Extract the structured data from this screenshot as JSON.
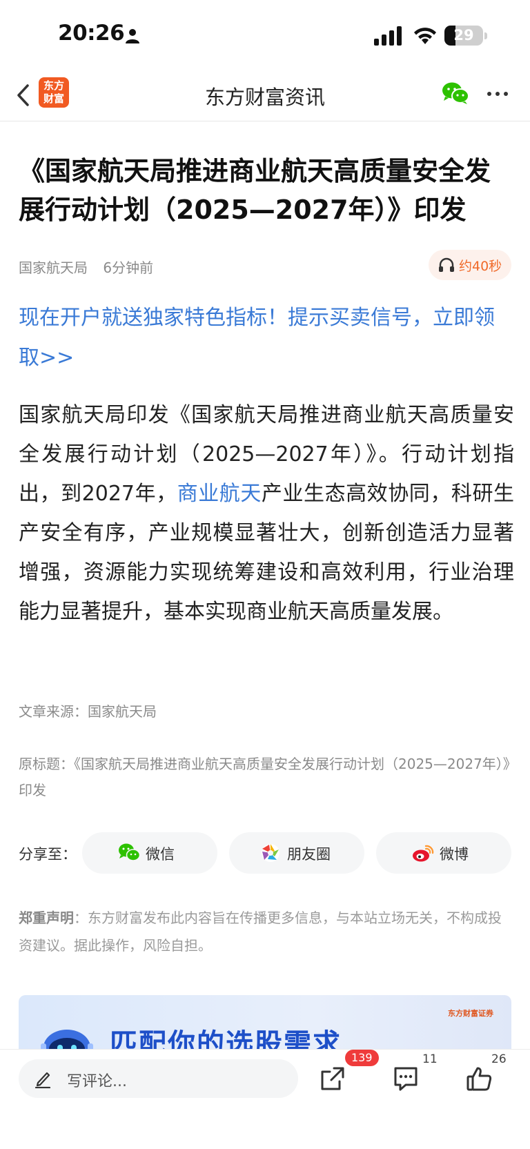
{
  "status_bar": {
    "time": "20:26",
    "battery": "29",
    "battery_fraction": 0.29
  },
  "nav": {
    "logo_line1": "东方",
    "logo_line2": "财富",
    "title": "东方财富资讯"
  },
  "article": {
    "title": "《国家航天局推进商业航天高质量安全发展行动计划（2025—2027年）》印发",
    "author": "国家航天局",
    "time_ago": "6分钟前",
    "audio_duration": "约40秒",
    "promo_link": "现在开户就送独家特色指标！提示买卖信号，立即领取>>",
    "body_before_link": "国家航天局印发《国家航天局推进商业航天高质量安全发展行动计划（2025—2027年）》。行动计划指出，到2027年，",
    "body_link": "商业航天",
    "body_after_link": "产业生态高效协同，科研生产安全有序，产业规模显著壮大，创新创造活力显著增强，资源能力实现统筹建设和高效利用，行业治理能力显著提升，基本实现商业航天高质量发展。",
    "source": "文章来源：国家航天局",
    "original_title": "原标题：《国家航天局推进商业航天高质量安全发展行动计划（2025—2027年）》印发"
  },
  "share": {
    "label": "分享至：",
    "wechat": "微信",
    "moments": "朋友圈",
    "weibo": "微博"
  },
  "disclaimer": {
    "label": "郑重声明",
    "text": "：东方财富发布此内容旨在传播更多信息，与本站立场无关，不构成投资建议。据此操作，风险自担。"
  },
  "banner": {
    "text": "匹配你的选股需求",
    "logo": "东方财富证券"
  },
  "bottom_bar": {
    "comment_placeholder": "写评论...",
    "share_count": "139",
    "comment_count": "11",
    "like_count": "26"
  },
  "colors": {
    "link_blue": "#3a7ad6",
    "brand_orange": "#f15a22",
    "badge_red": "#ef3b3b",
    "wechat_green": "#2dc100"
  }
}
